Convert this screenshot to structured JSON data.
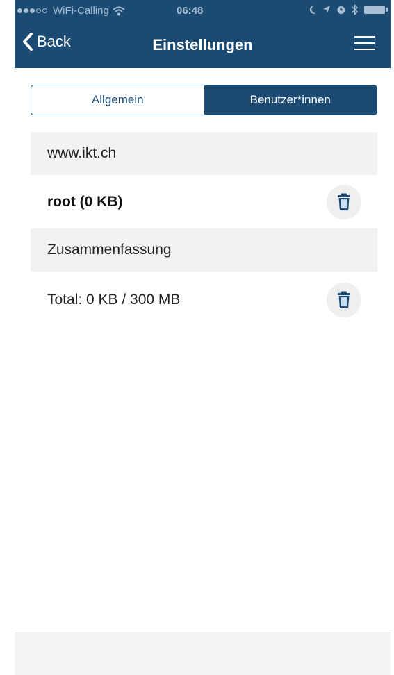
{
  "status_bar": {
    "carrier": "WiFi-Calling",
    "time": "06:48",
    "icons": [
      "signal-dots-icon",
      "wifi-icon",
      "moon-icon",
      "location-icon",
      "alarm-icon",
      "bluetooth-icon",
      "battery-icon"
    ]
  },
  "nav": {
    "back_label": "Back",
    "title": "Einstellungen",
    "menu_icon": "hamburger-menu-icon"
  },
  "tabs": [
    {
      "label": "Allgemein",
      "active": false
    },
    {
      "label": "Benutzer*innen",
      "active": true
    }
  ],
  "list": {
    "server_header": "www.ikt.ch",
    "user_item": "root (0 KB)",
    "summary_header": "Zusammenfassung",
    "total_item": "Total: 0 KB / 300 MB"
  },
  "colors": {
    "primary": "#1b4a72",
    "header_background": "#f2f2f2",
    "icon_background": "#efefef"
  }
}
